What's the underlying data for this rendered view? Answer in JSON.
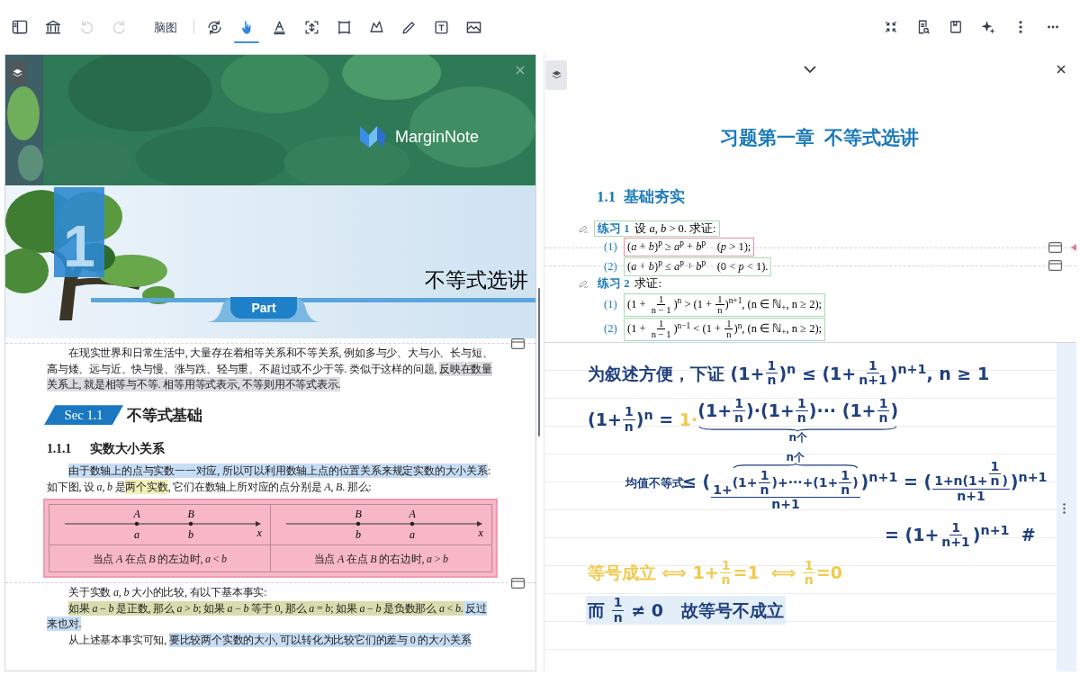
{
  "toolbar": {
    "file_buttons": [
      {
        "disabled": false
      },
      {
        "disabled": false
      },
      {
        "disabled": true
      },
      {
        "disabled": true
      }
    ],
    "mode_label": "脑图",
    "tools": [
      {
        "selected": false
      },
      {
        "selected": true
      },
      {
        "selected": false
      },
      {
        "selected": false
      },
      {
        "selected": false
      },
      {
        "selected": false
      },
      {
        "selected": false
      },
      {
        "selected": false
      },
      {
        "selected": false
      }
    ]
  },
  "document": {
    "logo": "MarginNote",
    "chapter": {
      "number": "1",
      "title": "不等式选讲",
      "tab": "Part"
    },
    "blocks": [
      {
        "kind": "separator"
      },
      {
        "kind": "paragraph",
        "segments": [
          {
            "text": "在现实世界和日常生活中, 大量存在着相等关系和不等关系, 例如多与少、大与小、长与短、高与矮、远与近、快与慢、涨与跌、轻与重、不超过或不少于等. 类似于这样的问题, "
          },
          {
            "text": "反映在数量关系上, 就是相等与不等. 相等用等式表示, 不等则用不等式表示.",
            "color": "#dcdde0"
          }
        ]
      },
      {
        "kind": "section",
        "badge": "Sec 1.1",
        "title": "不等式基础"
      },
      {
        "kind": "subsection",
        "number": "1.1.1",
        "title": "实数大小关系"
      },
      {
        "kind": "paragraph",
        "segments": [
          {
            "text": "由于数轴上的点与实数一一对应, 所以可以利用数轴上点的位置关系来规定实数的大小关系",
            "color": "#c7ddf5"
          },
          {
            "text": ": 如下图, 设 *a*, *b* 是"
          },
          {
            "text": "两个实数",
            "color": "#f3f0b8"
          },
          {
            "text": ", 它们在数轴上所对应的点分别是 *A*, *B*. 那么:"
          }
        ]
      },
      {
        "kind": "table",
        "figures": [
          {
            "points": [
              {
                "upper": "A",
                "lower": "a"
              },
              {
                "upper": "B",
                "lower": "b"
              }
            ],
            "axis": "x"
          },
          {
            "points": [
              {
                "upper": "B",
                "lower": "b"
              },
              {
                "upper": "A",
                "lower": "a"
              }
            ],
            "axis": "x"
          }
        ],
        "captions": [
          "当点 *A* 在点 *B* 的左边时, *a* < *b*",
          "当点 *A* 在点 *B* 的右边时, *a* > *b*"
        ]
      },
      {
        "kind": "separator"
      },
      {
        "kind": "paragraph",
        "segments": [
          {
            "text": "关于实数 *a*, *b* 大小的比较, 有以下基本事实:"
          }
        ]
      },
      {
        "kind": "paragraph",
        "segments": [
          {
            "text": "如果 *a* − *b* 是正数, 那么 *a* > *b*; 如果 *a* − *b* 等于 0, 那么 *a* = *b*; 如果 *a* − *b* 是负数那么 *a* < *b*.",
            "color": "#d8dcae"
          },
          {
            "text": " 反过来也对.",
            "color": "#c7ddf5"
          }
        ]
      },
      {
        "kind": "paragraph",
        "segments": [
          {
            "text": "从上述基本事实可知, "
          },
          {
            "text": "要比较两个实数的大小, 可以转化为比较它们的差与 0 的大小关系",
            "color": "#c7ddf5"
          }
        ]
      }
    ]
  },
  "exercise_page": {
    "title": "习题第一章  不等式选讲",
    "section": "1.1  基础夯实",
    "exercises": [
      {
        "label": "练习 1",
        "prompt": "设 *a*, *b* > 0. 求证:",
        "color": "#a8dcb4",
        "items": [
          {
            "number": "(1)",
            "color": "#e7909f",
            "parts": [
              "(*a* + *b*)$^{p}$ ≥ *a*$^{p}$ + *b*$^{p}$    (*p* > 1);"
            ]
          },
          {
            "number": "(2)",
            "color": "#a8dcb4",
            "parts": [
              "(*a* + *b*)$^{p}$ ≤ *a*$^{p}$ + *b*$^{p}$    (0 < *p* < 1)."
            ]
          }
        ]
      },
      {
        "label": "练习 2",
        "prompt": "求证:",
        "items": [
          {
            "number": "(1)",
            "color": "#a8dcb4",
            "parts": [
              "(1 + ",
              {
                "kind": "frac",
                "num": "1",
                "den": "n − 1"
              },
              ")$^{n}$ > (1 + ",
              {
                "kind": "frac",
                "num": "1",
                "den": "n"
              },
              ")$^{n+1}$, (n ∈ ℕ$_{+}$, n ≥ 2);"
            ]
          },
          {
            "number": "(2)",
            "color": "#a8dcb4",
            "parts": [
              "(1 + ",
              {
                "kind": "frac",
                "num": "1",
                "den": "n − 1"
              },
              ")$^{n−1}$ < (1 + ",
              {
                "kind": "frac",
                "num": "1",
                "den": "n"
              },
              ")$^{n}$, (n ∈ ℕ$_{+}$, n ≥ 2);"
            ]
          }
        ]
      }
    ]
  },
  "notes": {
    "lines": [
      {
        "kind": "line",
        "color": "#1f3f7d",
        "highlighted": false,
        "parts": [
          "为叙述方便，下证 (1+",
          {
            "kind": "frac",
            "num": "1",
            "den": "n"
          },
          ")$^{n}$ ≤ (1+",
          {
            "kind": "frac",
            "num": "1",
            "den": "n+1"
          },
          ")$^{n+1}$, n ≥ 1"
        ]
      },
      {
        "kind": "line",
        "color": "#1f3f7d",
        "highlighted": false,
        "parts": [
          "(1+",
          {
            "kind": "frac",
            "num": "1",
            "den": "n"
          },
          ")$^{n}$ = ",
          {
            "kind": "text",
            "text": "1·",
            "color": "#f2c94c"
          },
          {
            "kind": "underbrace",
            "label": "n个",
            "parts": [
              "(1+",
              {
                "kind": "frac",
                "num": "1",
                "den": "n"
              },
              ")·(1+",
              {
                "kind": "frac",
                "num": "1",
                "den": "n"
              },
              ")··· (1+",
              {
                "kind": "frac",
                "num": "1",
                "den": "n"
              },
              ")"
            ]
          }
        ]
      },
      {
        "kind": "step",
        "color": "#1f3f7d",
        "highlighted": false,
        "note": "均值不等式",
        "parts": [
          "≤ (",
          {
            "kind": "frac",
            "num": [
              "1+",
              {
                "kind": "overbrace",
                "label": "n个",
                "parts": [
                  "(1+",
                  {
                    "kind": "frac",
                    "num": "1",
                    "den": "n"
                  },
                  ")+···+(1+",
                  {
                    "kind": "frac",
                    "num": "1",
                    "den": "n"
                  },
                  ")"
                ]
              }
            ],
            "den": "n+1"
          },
          ")$^{n+1}$ = (",
          {
            "kind": "frac",
            "num": [
              "1+n(1+",
              {
                "kind": "frac",
                "num": "1",
                "den": "n"
              },
              ")"
            ],
            "den": "n+1"
          },
          ")$^{n+1}$"
        ]
      },
      {
        "kind": "continuation",
        "color": "#1f3f7d",
        "highlighted": false,
        "parts": [
          "= (1+",
          {
            "kind": "frac",
            "num": "1",
            "den": "n+1"
          },
          ")$^{n+1}$  #"
        ]
      },
      {
        "kind": "line",
        "color": "#f2c94c",
        "highlighted": false,
        "parts": [
          "等号成立 ⟺ 1+",
          {
            "kind": "frac",
            "num": "1",
            "den": "n"
          },
          "=1  ⟺ ",
          {
            "kind": "frac",
            "num": "1",
            "den": "n"
          },
          "=0"
        ]
      },
      {
        "kind": "line",
        "color": "#1f3f7d",
        "highlighted": true,
        "parts": [
          "而 ",
          {
            "kind": "frac",
            "num": "1",
            "den": "n"
          },
          " ≠ 0   故等号不成立"
        ]
      }
    ]
  }
}
